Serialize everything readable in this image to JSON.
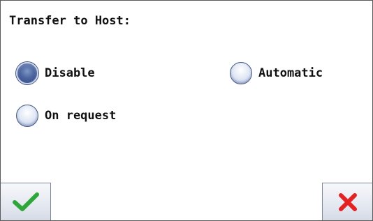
{
  "dialog": {
    "title": "Transfer to Host:"
  },
  "options": [
    {
      "label": "Disable",
      "selected": true
    },
    {
      "label": "Automatic",
      "selected": false
    },
    {
      "label": "On request",
      "selected": false
    }
  ],
  "buttons": {
    "ok_icon": "checkmark-icon",
    "cancel_icon": "cross-icon"
  },
  "colors": {
    "ok_green": "#2fa63a",
    "cancel_red": "#e52222",
    "radio_selected": "#3d5592"
  }
}
